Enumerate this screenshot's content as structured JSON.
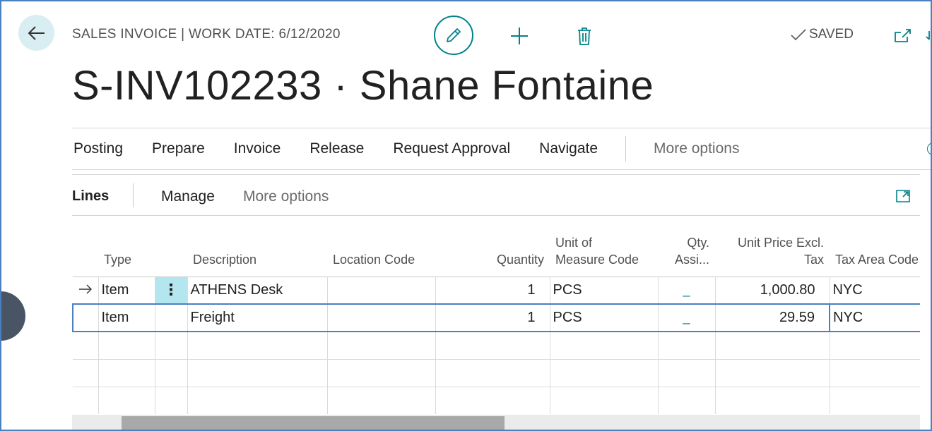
{
  "header": {
    "caption": "SALES INVOICE | WORK DATE: 6/12/2020",
    "title": "S-INV102233 · Shane Fontaine",
    "status": "SAVED"
  },
  "icons": {
    "back": "back-arrow-icon",
    "edit": "pencil-icon",
    "new": "plus-icon",
    "delete": "trash-icon",
    "saved": "checkmark-icon",
    "popout": "open-in-new-window-icon"
  },
  "actions": [
    "Posting",
    "Prepare",
    "Invoice",
    "Release",
    "Request Approval",
    "Navigate"
  ],
  "actions_more": "More options",
  "lines": {
    "title": "Lines",
    "manage": "Manage",
    "more": "More options"
  },
  "grid": {
    "columns": {
      "type": "Type",
      "description": "Description",
      "location": "Location Code",
      "quantity": "Quantity",
      "uom_1": "Unit of",
      "uom_2": "Measure Code",
      "qty_1": "Qty.",
      "qty_2": "Assi...",
      "price_1": "Unit Price Excl.",
      "price_2": "Tax",
      "tax_area": "Tax Area Code"
    },
    "rows": [
      {
        "type": "Item",
        "description": "ATHENS Desk",
        "location": "",
        "quantity": "1",
        "uom": "PCS",
        "qty_assigned": "_",
        "unit_price": "1,000.80",
        "tax_area": "NYC"
      },
      {
        "type": "Item",
        "description": "Freight",
        "location": "",
        "quantity": "1",
        "uom": "PCS",
        "qty_assigned": "_",
        "unit_price": "29.59",
        "tax_area": "NYC"
      }
    ]
  },
  "colors": {
    "accent": "#00828b",
    "frame": "#4a7fc1",
    "selected_cell": "#b3e6ee"
  }
}
